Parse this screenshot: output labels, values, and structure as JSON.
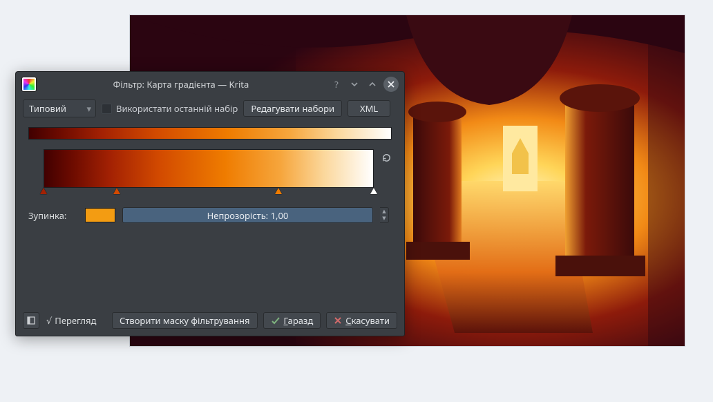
{
  "dialog": {
    "title": "Фільтр: Карта градієнта — Krita",
    "preset_select": "Типовий",
    "use_last": "Використати останній набір",
    "edit_presets": "Редагувати набори",
    "xml": "XML"
  },
  "gradient": {
    "preview_stops": [
      {
        "p": 0,
        "c": "#410000"
      },
      {
        "p": 8,
        "c": "#6a0a00"
      },
      {
        "p": 20,
        "c": "#a32103"
      },
      {
        "p": 35,
        "c": "#d24a00"
      },
      {
        "p": 55,
        "c": "#ef7c00"
      },
      {
        "p": 72,
        "c": "#f6a63d"
      },
      {
        "p": 85,
        "c": "#fbd79b"
      },
      {
        "p": 100,
        "c": "#ffffff"
      }
    ],
    "editor_stops": [
      {
        "p": 0,
        "c": "#410000"
      },
      {
        "p": 8,
        "c": "#6a0a00"
      },
      {
        "p": 20,
        "c": "#a32103"
      },
      {
        "p": 35,
        "c": "#d24a00"
      },
      {
        "p": 55,
        "c": "#ef7c00"
      },
      {
        "p": 72,
        "c": "#f6a63d"
      },
      {
        "p": 85,
        "c": "#fbd79b"
      },
      {
        "p": 100,
        "c": "#ffffff"
      }
    ],
    "markers": [
      {
        "p": 0,
        "c": "#a32103"
      },
      {
        "p": 22,
        "c": "#d24a00"
      },
      {
        "p": 71,
        "c": "#ef7c00"
      },
      {
        "p": 100,
        "c": "#ffffff"
      }
    ],
    "stop_label": "Зупинка:",
    "stop_color": "#f39c12",
    "opacity_label": "Непрозорість:",
    "opacity_value": "1,00",
    "opacity_fill": 100
  },
  "bottom": {
    "preview": "Перегляд",
    "preview_checked": true,
    "create_mask": "Створити маску фільтрування",
    "ok_full": "Гаразд",
    "ok_u": "Г",
    "ok_rest": "аразд",
    "cancel_full": "Скасувати",
    "cancel_u": "С",
    "cancel_rest": "касувати"
  }
}
